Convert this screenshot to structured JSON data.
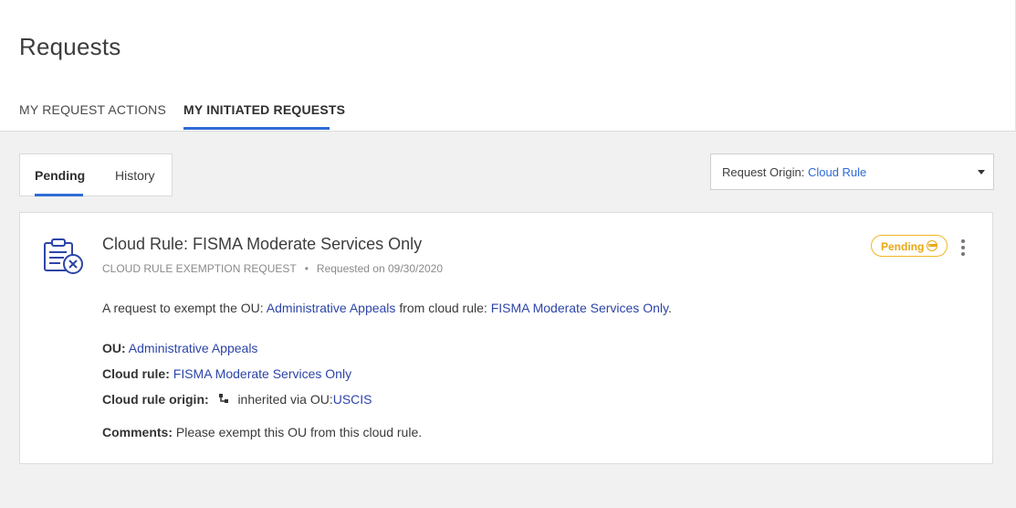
{
  "page": {
    "title": "Requests"
  },
  "tabs": [
    {
      "label": "MY REQUEST ACTIONS",
      "active": false
    },
    {
      "label": "MY INITIATED REQUESTS",
      "active": true
    }
  ],
  "subtabs": [
    {
      "label": "Pending",
      "active": true
    },
    {
      "label": "History",
      "active": false
    }
  ],
  "filter": {
    "label": "Request Origin:",
    "value": "Cloud Rule"
  },
  "request": {
    "title": "Cloud Rule: FISMA Moderate Services Only",
    "type": "CLOUD RULE EXEMPTION REQUEST",
    "separator": "•",
    "requested_on": "Requested on 09/30/2020",
    "status": "Pending",
    "description": {
      "prefix": "A request to exempt the OU:",
      "ou": "Administrative Appeals",
      "middle": "from cloud rule:",
      "rule": "FISMA Moderate Services Only",
      "suffix": "."
    },
    "fields": {
      "ou_label": "OU:",
      "ou_value": "Administrative Appeals",
      "rule_label": "Cloud rule:",
      "rule_value": "FISMA Moderate Services Only",
      "origin_label": "Cloud rule origin:",
      "origin_text": "inherited via OU:",
      "origin_ou": "USCIS",
      "comments_label": "Comments:",
      "comments_value": "Please exempt this OU from this cloud rule."
    }
  },
  "colors": {
    "accent": "#2f6bd6",
    "link": "#2d45a8",
    "pending": "#f0b623",
    "background": "#f1f1f1"
  },
  "icons": {
    "request": "clipboard-x-icon",
    "status": "more-circle-icon",
    "menu": "kebab-menu-icon",
    "origin": "hierarchy-icon",
    "dropdown": "caret-down-icon"
  }
}
